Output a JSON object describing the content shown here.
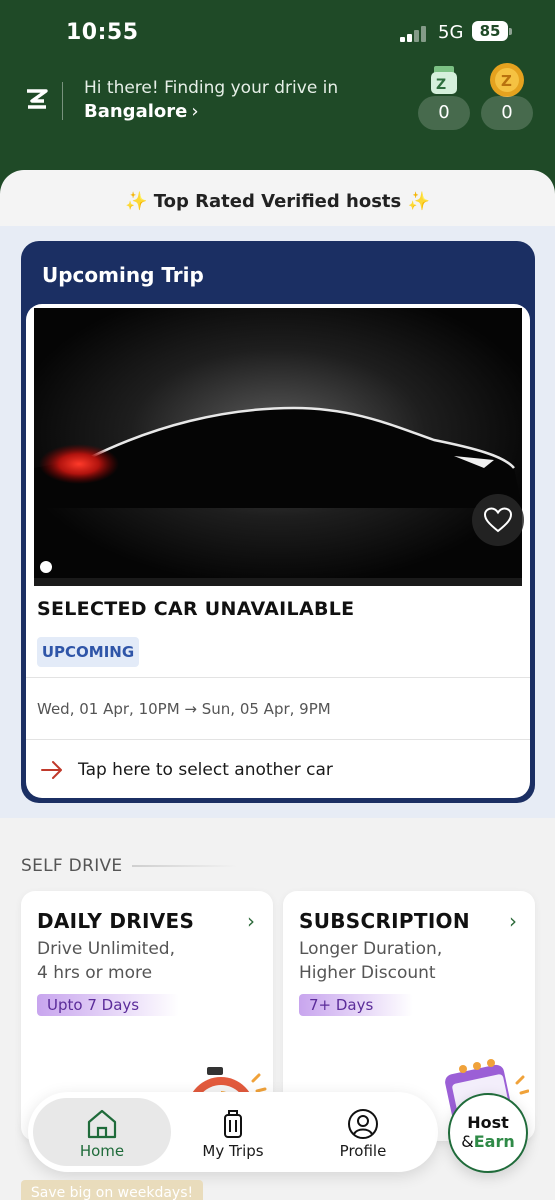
{
  "status_bar": {
    "time": "10:55",
    "network": "5G",
    "battery": "85"
  },
  "header": {
    "greeting": "Hi there! Finding your drive in",
    "city": "Bangalore",
    "city_chevron": "›",
    "wallet_cash": {
      "icon": "cash-wallet-icon",
      "value": "0"
    },
    "wallet_coins": {
      "icon": "zcoin-icon",
      "value": "0"
    }
  },
  "banner": {
    "text": "✨ Top Rated Verified hosts ✨"
  },
  "upcoming_trip": {
    "title": "Upcoming Trip",
    "car_name": "SELECTED CAR UNAVAILABLE",
    "status": "UPCOMING",
    "dates": "Wed, 01 Apr, 10PM → Sun, 05 Apr, 9PM",
    "cta": "Tap here to select another car"
  },
  "self_drive": {
    "label": "SELF DRIVE",
    "cards": [
      {
        "title": "DAILY DRIVES",
        "chevron": "›",
        "desc_line1": "Drive Unlimited,",
        "desc_line2": "4 hrs or more",
        "tag": "Upto 7 Days",
        "icon": "stopwatch-icon"
      },
      {
        "title": "SUBSCRIPTION",
        "chevron": "›",
        "desc_line1": "Longer Duration,",
        "desc_line2": "Higher Discount",
        "tag": "7+ Days",
        "icon": "calendar-car-icon"
      }
    ]
  },
  "nav": {
    "items": [
      {
        "label": "Home",
        "icon": "home-icon",
        "active": true
      },
      {
        "label": "My Trips",
        "icon": "luggage-icon",
        "active": false
      },
      {
        "label": "Profile",
        "icon": "profile-icon",
        "active": false
      }
    ],
    "host_line1": "Host",
    "host_amp": "&",
    "host_line2": "Earn"
  },
  "promo": {
    "text": "Save big on weekdays!"
  },
  "colors": {
    "header_green": "#1f4a27",
    "trip_navy": "#1b2f63",
    "accent_green": "#1f6b3a",
    "chip_blue": "#2f55a8",
    "tag_purple": "#c8a5ee",
    "cta_red": "#c0392b"
  }
}
